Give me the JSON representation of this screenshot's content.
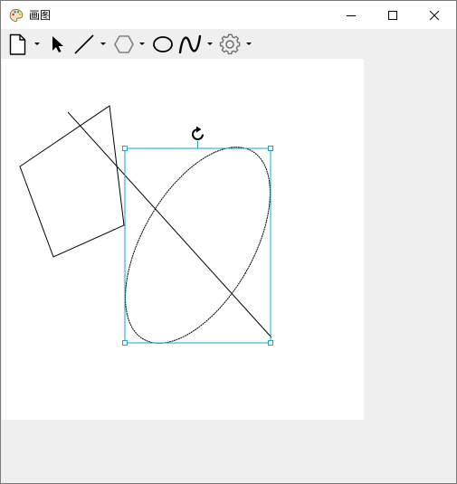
{
  "window": {
    "title": "画图"
  },
  "toolbar": {
    "tools": [
      {
        "name": "new-file",
        "icon": "document-icon",
        "has_dropdown": true
      },
      {
        "name": "select",
        "icon": "cursor-arrow-icon",
        "has_dropdown": false
      },
      {
        "name": "line",
        "icon": "line-icon",
        "has_dropdown": true
      },
      {
        "name": "polygon",
        "icon": "hexagon-icon",
        "has_dropdown": true
      },
      {
        "name": "ellipse",
        "icon": "ellipse-icon",
        "has_dropdown": false
      },
      {
        "name": "curve",
        "icon": "curve-icon",
        "has_dropdown": true
      },
      {
        "name": "settings",
        "icon": "gear-icon",
        "has_dropdown": true
      }
    ]
  },
  "canvas": {
    "background": "#ffffff",
    "shapes": [
      "quadrilateral",
      "line",
      "ellipse"
    ],
    "selection_color": "#1aa7c4"
  }
}
